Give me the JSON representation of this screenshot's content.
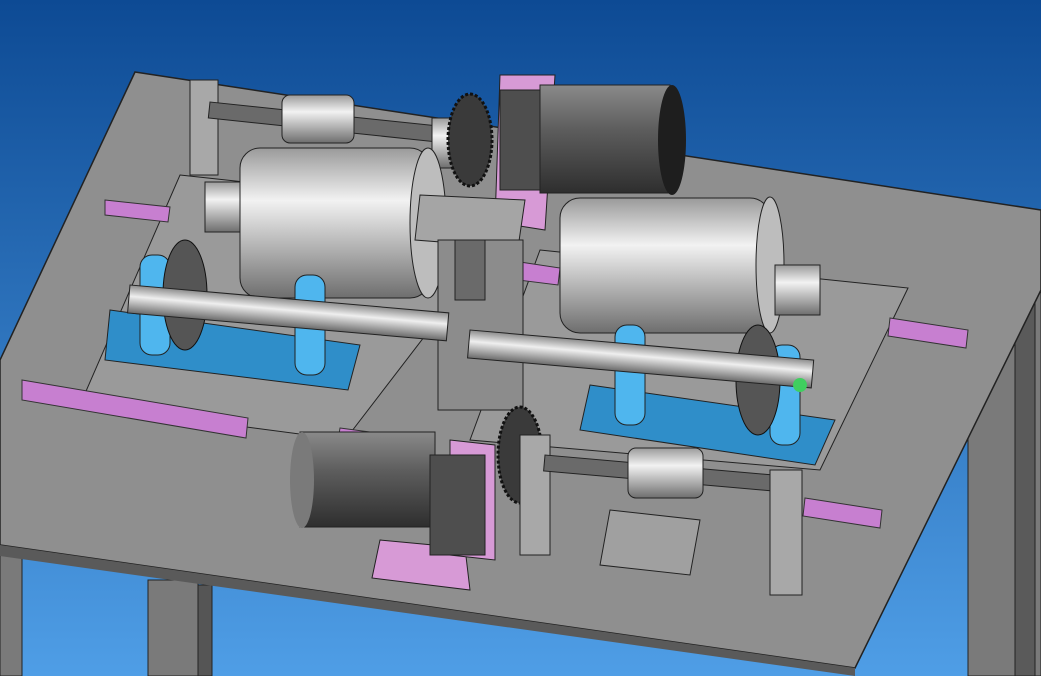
{
  "viewport": {
    "background_top": "#0d4a94",
    "background_bottom": "#4f9ee6"
  },
  "colors": {
    "table": "#8f8f8f",
    "table_edge": "#5a5a5a",
    "leg": "#7a7a7a",
    "rail": "#c77fd0",
    "bearing_base": "#2f8ec9",
    "bearing_housing": "#4fb6ee",
    "motor_body": "#cfcfcf",
    "gear_motor": "#5c5c5c",
    "mount_plate": "#d79ad6",
    "gear": "#3a3a3a"
  }
}
